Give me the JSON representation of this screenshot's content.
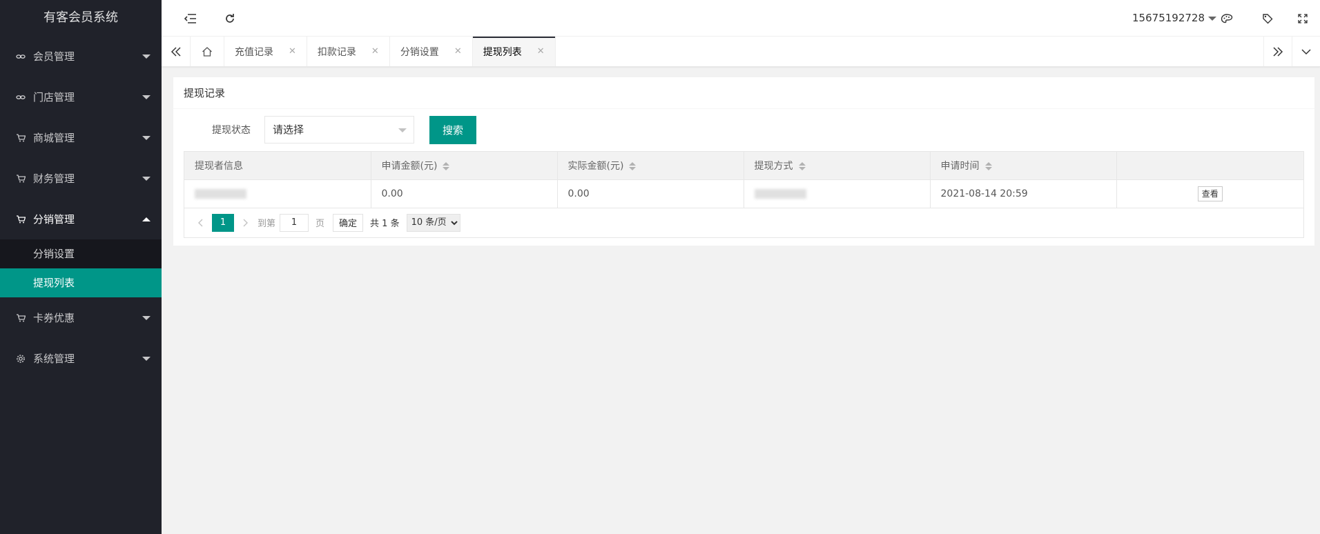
{
  "app": {
    "title": "有客会员系统"
  },
  "sidebar": {
    "items": [
      {
        "label": "会员管理",
        "icon": "link-icon"
      },
      {
        "label": "门店管理",
        "icon": "link-icon"
      },
      {
        "label": "商城管理",
        "icon": "cart-icon"
      },
      {
        "label": "财务管理",
        "icon": "cart-icon"
      },
      {
        "label": "分销管理",
        "icon": "cart-icon",
        "open": true,
        "children": [
          {
            "label": "分销设置"
          },
          {
            "label": "提现列表",
            "active": true
          }
        ]
      },
      {
        "label": "卡券优惠",
        "icon": "cart-icon"
      },
      {
        "label": "系统管理",
        "icon": "gear-icon"
      }
    ]
  },
  "header": {
    "username": "15675192728"
  },
  "tabs": [
    {
      "label": "充值记录"
    },
    {
      "label": "扣款记录"
    },
    {
      "label": "分销设置"
    },
    {
      "label": "提现列表",
      "active": true
    }
  ],
  "card": {
    "title": "提现记录"
  },
  "filter": {
    "label": "提现状态",
    "select_value": "请选择",
    "search_label": "搜索"
  },
  "table": {
    "columns": [
      "提现者信息",
      "申请金额(元)",
      "实际金额(元)",
      "提现方式",
      "申请时间",
      ""
    ],
    "rows": [
      {
        "apply_amount": "0.00",
        "actual_amount": "0.00",
        "time": "2021-08-14 20:59",
        "action": "查看"
      }
    ]
  },
  "pager": {
    "current": "1",
    "goto_label": "到第",
    "page_label": "页",
    "goto_value": "1",
    "confirm_label": "确定",
    "total": "共 1 条",
    "limit": "10 条/页"
  },
  "colors": {
    "accent": "#009688",
    "sidebar_bg": "#20222a"
  }
}
